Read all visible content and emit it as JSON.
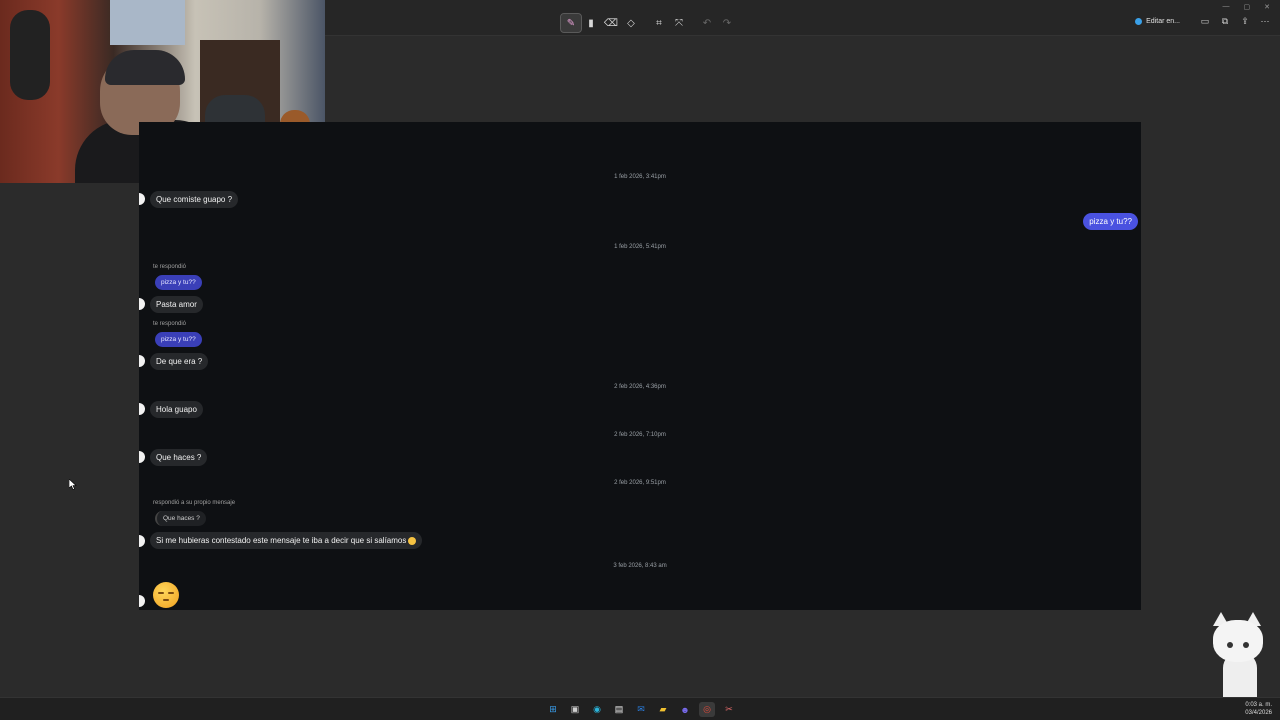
{
  "toolbar": {
    "tools": [
      {
        "name": "highlighter-pen-tool",
        "glyph": "✎",
        "active": true
      },
      {
        "name": "highlighter-tool",
        "glyph": "▮",
        "active": false
      },
      {
        "name": "eraser-tool",
        "glyph": "⌫",
        "active": false
      },
      {
        "name": "shapes-tool",
        "glyph": "◇",
        "active": false
      },
      {
        "name": "crop-tool",
        "glyph": "⌗",
        "active": false
      },
      {
        "name": "text-actions-tool",
        "glyph": "⤧",
        "active": false
      },
      {
        "name": "undo-tool",
        "glyph": "↶",
        "active": false,
        "disabled": true
      },
      {
        "name": "redo-tool",
        "glyph": "↷",
        "active": false,
        "disabled": true
      }
    ],
    "edit_label": "Editar en...",
    "actions": [
      "save-icon",
      "copy-icon",
      "share-icon",
      "more-icon"
    ]
  },
  "window_controls": {
    "minimize": "—",
    "restore": "▢",
    "close": "✕"
  },
  "chat": {
    "stamps": {
      "s1": "1 feb 2026, 3:41pm",
      "s2": "1 feb 2026, 5:41pm",
      "s3": "2 feb 2026, 4:36pm",
      "s4": "2 feb 2026, 7:10pm",
      "s5": "2 feb 2026, 9:51pm",
      "s6": "3 feb 2026, 8:43 am"
    },
    "messages": {
      "m1": "Que comiste guapo ?",
      "mine1": "pizza y tu??",
      "reply_label1": "te respondió",
      "reply_quote1": "pizza y tu??",
      "m2": "Pasta amor",
      "reply_label2": "te respondió",
      "reply_quote2": "pizza y tu??",
      "m3": "De que era ?",
      "m4": "Hola guapo",
      "m5": "Que haces ?",
      "reply_label3": "respondió a su propio mensaje",
      "reply_quote3": "Que haces ?",
      "m6": "Si me hubieras contestado este mensaje te iba a decir que si salíamos"
    }
  },
  "taskbar": {
    "icons": [
      {
        "name": "windows-start-icon",
        "glyph": "⊞",
        "color": "#3aa0f0"
      },
      {
        "name": "task-view-icon",
        "glyph": "▣",
        "color": "#cfcfcf"
      },
      {
        "name": "edge-browser-icon",
        "glyph": "◉",
        "color": "#2bb3d9"
      },
      {
        "name": "store-icon",
        "glyph": "▤",
        "color": "#f0f0f0"
      },
      {
        "name": "mail-icon",
        "glyph": "✉",
        "color": "#2a7fe0"
      },
      {
        "name": "file-explorer-icon",
        "glyph": "▰",
        "color": "#f2c230"
      },
      {
        "name": "discord-icon",
        "glyph": "☻",
        "color": "#7a6cf0"
      },
      {
        "name": "chrome-icon",
        "glyph": "◎",
        "color": "#e04a3a"
      },
      {
        "name": "snipping-tool-icon",
        "glyph": "✂",
        "color": "#e06a6a"
      }
    ],
    "time": "0:03 a. m.",
    "date": "03/4/2026"
  }
}
